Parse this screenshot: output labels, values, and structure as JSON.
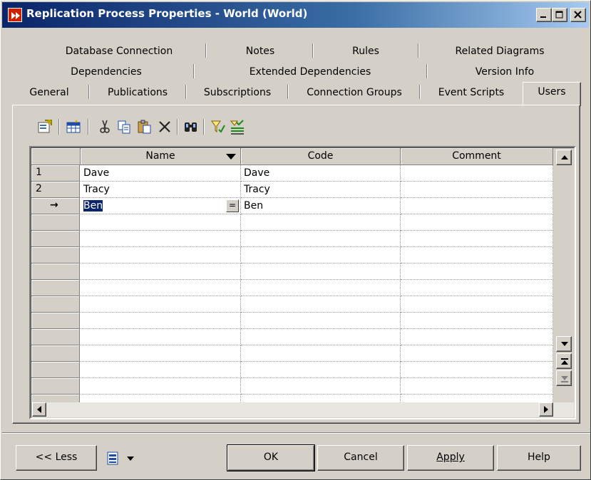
{
  "window": {
    "title": "Replication Process Properties - World (World)"
  },
  "tabs": {
    "row1": [
      "Database Connection",
      "Notes",
      "Rules",
      "Related Diagrams"
    ],
    "row2": [
      "Dependencies",
      "Extended Dependencies",
      "Version Info"
    ],
    "row3": [
      "General",
      "Publications",
      "Subscriptions",
      "Connection Groups",
      "Event Scripts",
      "Users"
    ],
    "active": "Users"
  },
  "toolbar": {
    "icons": [
      "properties-icon",
      "add-rows-icon",
      "cut-icon",
      "copy-icon",
      "paste-icon",
      "delete-icon",
      "find-icon",
      "filter-icon",
      "customize-columns-icon"
    ]
  },
  "grid": {
    "columns": [
      "Name",
      "Code",
      "Comment"
    ],
    "rows": [
      {
        "marker": "1",
        "name": "Dave",
        "code": "Dave",
        "comment": ""
      },
      {
        "marker": "2",
        "name": "Tracy",
        "code": "Tracy",
        "comment": ""
      },
      {
        "marker": "→",
        "name": "Ben",
        "code": "Ben",
        "comment": ""
      }
    ],
    "empty_row_count": 12,
    "edit_button": "="
  },
  "buttons": {
    "less": "<< Less",
    "ok": "OK",
    "cancel": "Cancel",
    "apply": "Apply",
    "help": "Help"
  }
}
